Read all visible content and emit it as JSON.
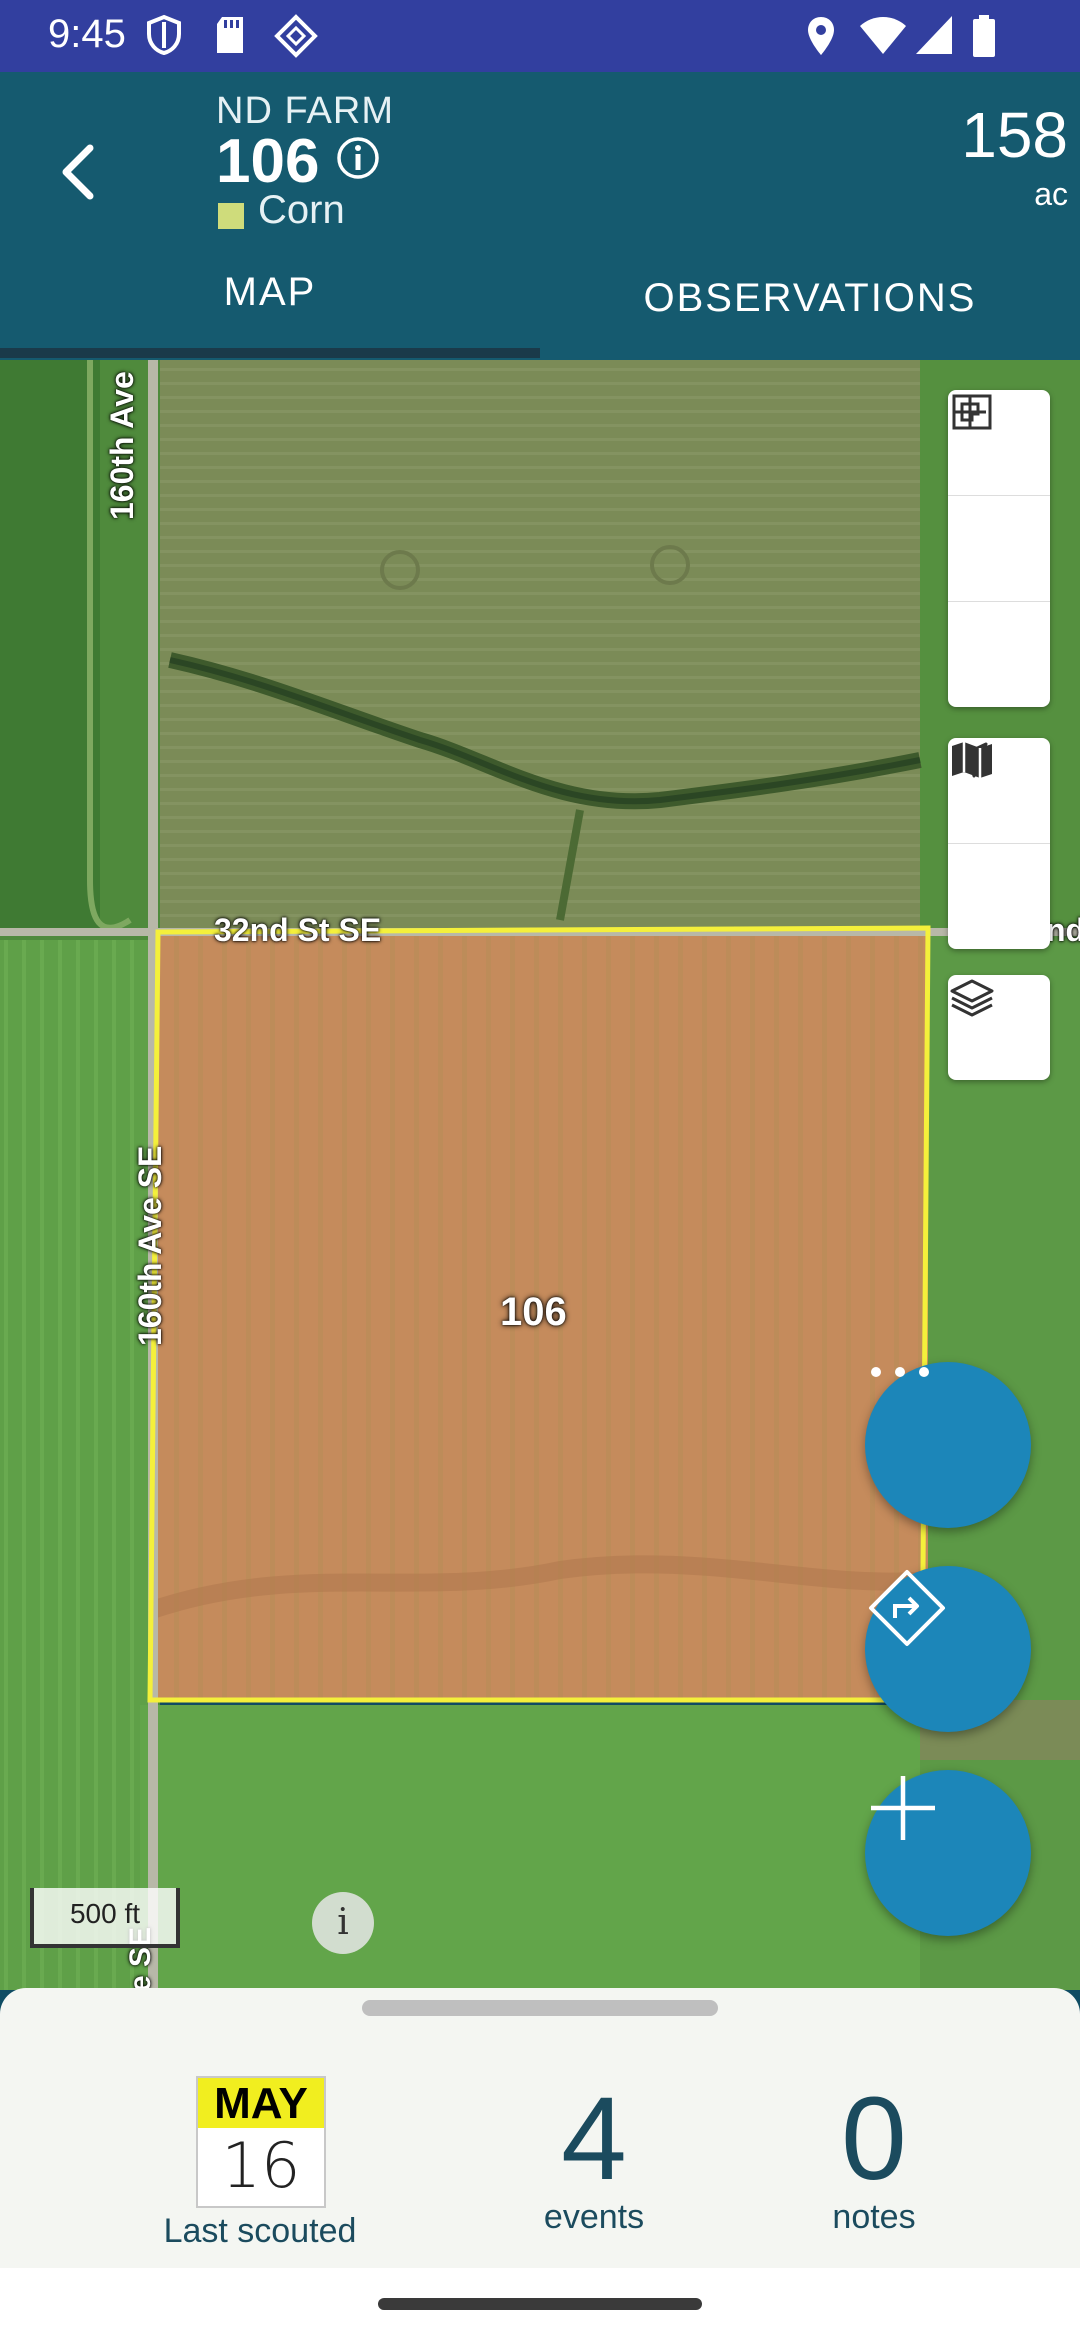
{
  "status_bar": {
    "time": "9:45"
  },
  "header": {
    "farm": "ND FARM",
    "field": "106",
    "crop": "Corn",
    "crop_color": "#cfdc7b",
    "acres": "158",
    "acres_unit": "ac"
  },
  "tabs": [
    {
      "label": "MAP",
      "selected": true
    },
    {
      "label": "OBSERVATIONS",
      "selected": false
    }
  ],
  "map": {
    "roads": {
      "north_south": "160th Ave",
      "north_south_lower": "160th Ave SE",
      "east_west": "32nd St SE",
      "east_west_clipped": "nd",
      "bottom_clipped": "e SE"
    },
    "field_label": "106",
    "field_boundary_color": "#f4f03b",
    "scale": "500 ft",
    "controls": [
      "zoom-in",
      "zoom-out",
      "fit-field",
      "my-location",
      "map-type",
      "layers"
    ],
    "fabs": [
      "more-options",
      "directions",
      "add"
    ]
  },
  "summary": {
    "month": "MAY",
    "day": "16",
    "last_scouted_label": "Last scouted",
    "events_count": "4",
    "events_label": "events",
    "notes_count": "0",
    "notes_label": "notes"
  },
  "colors": {
    "status_bar": "#323f9f",
    "header": "#155a6f",
    "accent": "#1c86b9"
  }
}
